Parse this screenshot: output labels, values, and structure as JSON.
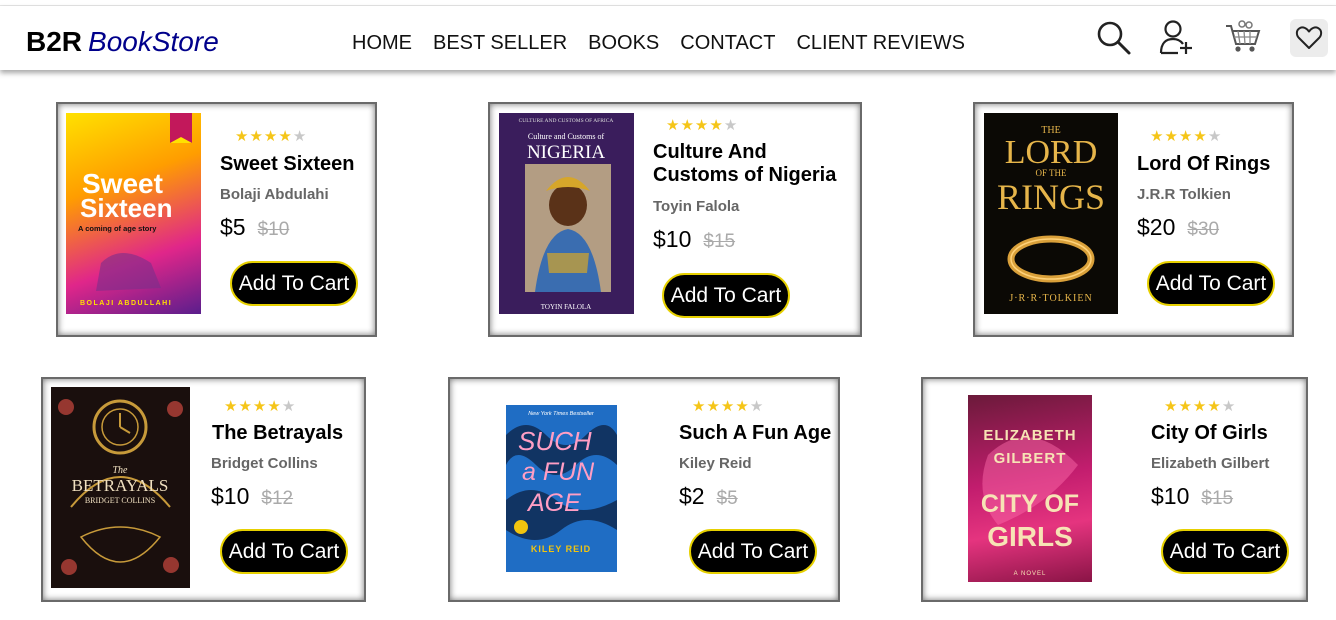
{
  "header": {
    "logo_main": "B2R",
    "logo_sub": "BookStore",
    "nav": [
      "HOME",
      "BEST SELLER",
      "BOOKS",
      "CONTACT",
      "CLIENT REVIEWS"
    ]
  },
  "colors": {
    "accent": "#00008b",
    "star": "#f5c518",
    "button_border": "#e6d000"
  },
  "icons": [
    "search-icon",
    "add-user-icon",
    "cart-icon",
    "heart-icon"
  ],
  "cart_button_label": "Add To Cart",
  "books": [
    {
      "cover_text": [
        "Sweet",
        "Sixteen",
        "A coming of age story",
        "BOLAJI ABDULLAHI"
      ],
      "rating": 4,
      "title": "Sweet Sixteen",
      "author": "Bolaji Abdulahi",
      "price": "$5",
      "old_price": "$10"
    },
    {
      "cover_text": [
        "CULTURE AND CUSTOMS OF AFRICA",
        "Culture and Customs of",
        "NIGERIA",
        "TOYIN FALOLA"
      ],
      "rating": 4,
      "title": "Culture And Customs of Nigeria",
      "author": "Toyin Falola",
      "price": "$10",
      "old_price": "$15"
    },
    {
      "cover_text": [
        "THE",
        "LORD",
        "OF THE",
        "RINGS",
        "J·R·R·TOLKIEN"
      ],
      "rating": 4,
      "title": "Lord Of Rings",
      "author": "J.R.R Tolkien",
      "price": "$20",
      "old_price": "$30"
    },
    {
      "cover_text": [
        "The",
        "BETRAYALS",
        "BRIDGET COLLINS"
      ],
      "rating": 4,
      "title": "The Betrayals",
      "author": "Bridget Collins",
      "price": "$10",
      "old_price": "$12"
    },
    {
      "cover_text": [
        "New York Times Bestseller",
        "SUCH",
        "a FUN",
        "AGE",
        "KILEY REID"
      ],
      "rating": 4,
      "title": "Such A Fun Age",
      "author": "Kiley Reid",
      "price": "$2",
      "old_price": "$5"
    },
    {
      "cover_text": [
        "ELIZABETH",
        "GILBERT",
        "CITY OF",
        "GIRLS",
        "A NOVEL"
      ],
      "rating": 4,
      "title": "City Of Girls",
      "author": "Elizabeth Gilbert",
      "price": "$10",
      "old_price": "$15"
    }
  ]
}
